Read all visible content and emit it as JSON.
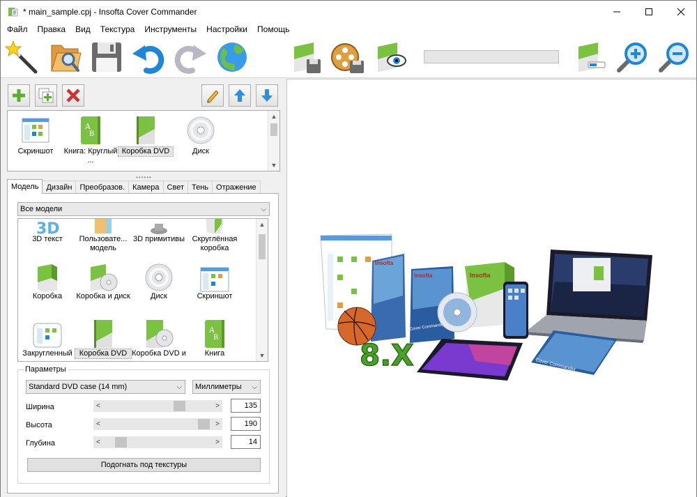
{
  "window": {
    "title": "* main_sample.cpj - Insofta Cover Commander"
  },
  "menu": [
    "Файл",
    "Правка",
    "Вид",
    "Текстура",
    "Инструменты",
    "Настройки",
    "Помощь"
  ],
  "objects": [
    {
      "label": "Скриншот"
    },
    {
      "label": "Книга: Круглый ..."
    },
    {
      "label": "Коробка DVD"
    },
    {
      "label": "Диск"
    }
  ],
  "tabs": [
    "Модель",
    "Дизайн",
    "Преобразов.",
    "Камера",
    "Свет",
    "Тень",
    "Отражение"
  ],
  "models_filter": "Все модели",
  "models": [
    {
      "label": "3D текст"
    },
    {
      "label": "Пользовате... модель"
    },
    {
      "label": "3D примитивы"
    },
    {
      "label": "Скруглённая коробка"
    },
    {
      "label": "Коробка"
    },
    {
      "label": "Коробка и диск"
    },
    {
      "label": "Диск"
    },
    {
      "label": "Скриншот"
    },
    {
      "label": "Закругленный"
    },
    {
      "label": "Коробка DVD"
    },
    {
      "label": "Коробка DVD и"
    },
    {
      "label": "Книга"
    }
  ],
  "params": {
    "legend": "Параметры",
    "preset": "Standard DVD case (14 mm)",
    "units": "Миллиметры",
    "rows": [
      {
        "label": "Ширина",
        "value": "135",
        "level": 0.72
      },
      {
        "label": "Высота",
        "value": "190",
        "level": 0.97
      },
      {
        "label": "Глубина",
        "value": "14",
        "level": 0.12
      }
    ],
    "fit_button": "Подогнать под текстуры"
  },
  "preview": {
    "badge": "8.X",
    "brand": "Insofta",
    "product": "Cover Commander"
  },
  "colors": {
    "accent_green": "#7cc242",
    "icon_blue": "#1f86d6",
    "delete_red": "#d03030",
    "selection_gray": "#e5e5e5"
  }
}
